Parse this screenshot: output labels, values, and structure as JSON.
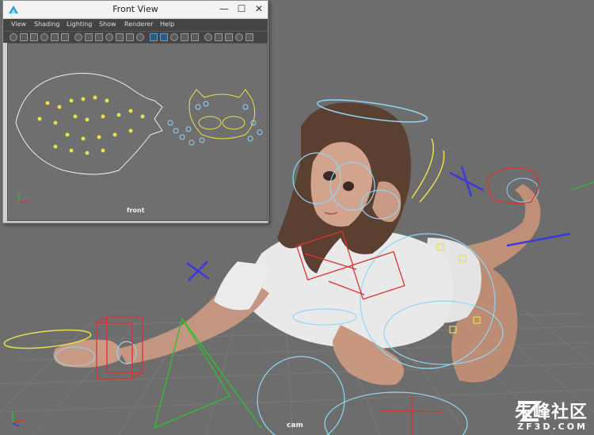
{
  "window": {
    "title": "Front View",
    "controls": {
      "minimize": "—",
      "maximize": "☐",
      "close": "✕"
    }
  },
  "menubar": [
    "View",
    "Shading",
    "Lighting",
    "Show",
    "Renderer",
    "Help"
  ],
  "toolbar_icons": [
    "camera-icon",
    "camera-attr-icon",
    "bookmark-icon",
    "image-plane-icon",
    "pan-zoom-icon",
    "grease-pencil-icon",
    "grid-icon",
    "film-gate-icon",
    "resolution-gate-icon",
    "gate-mask-icon",
    "field-chart-icon",
    "safe-action-icon",
    "safe-title-icon",
    "wireframe-icon",
    "smooth-shade-icon",
    "use-default-material-icon",
    "wireframe-on-shaded-icon",
    "xray-icon",
    "xray-joints-icon",
    "use-all-lights-icon",
    "shadows-icon",
    "screen-space-ao-icon",
    "motion-blur-icon"
  ],
  "front_view": {
    "camera_label": "front"
  },
  "main_view": {
    "camera_label": "cam"
  },
  "watermark": {
    "title": "朱峰社区",
    "subtitle": "ZF3D.COM"
  },
  "colors": {
    "viewport_bg": "#6d6d6d",
    "grid": "#8a8a8a",
    "control_cyan": "#8fd6f2",
    "control_yellow": "#e6e04a",
    "control_red": "#e03030",
    "control_blue": "#3a3ad8",
    "control_green": "#2ec02e",
    "skin": "#c99b84",
    "shirt": "#eaeaea",
    "hair": "#5a3f30"
  }
}
